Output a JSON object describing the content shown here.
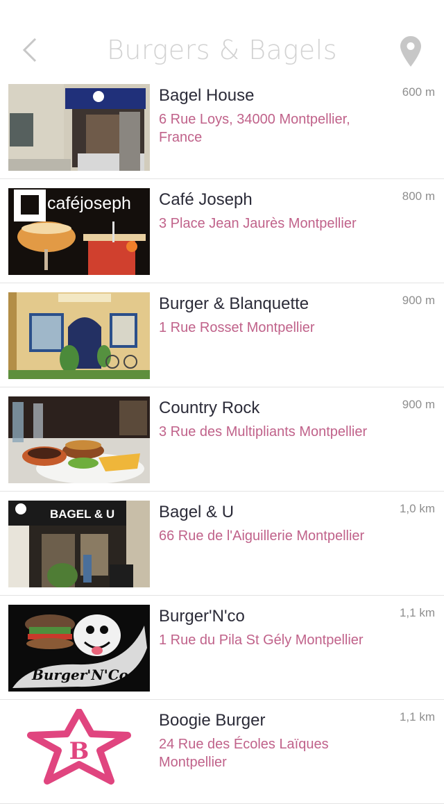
{
  "header": {
    "title": "Burgers & Bagels",
    "back_icon": "chevron-left-icon",
    "map_icon": "map-pin-icon",
    "title_color": "#d2d2d2",
    "icon_color": "#c7c7c7"
  },
  "theme": {
    "address_color": "#c0628a",
    "name_color": "#2b2b38",
    "distance_color": "#8e8e8e"
  },
  "restaurants": [
    {
      "name": "Bagel House",
      "address": "6 Rue Loys, 34000 Montpellier, France",
      "distance": "600 m"
    },
    {
      "name": "Café Joseph",
      "address": "3 Place Jean Jaurès Montpellier",
      "distance": "800 m",
      "logo_text": "caféjoseph"
    },
    {
      "name": "Burger & Blanquette",
      "address": "1 Rue Rosset Montpellier",
      "distance": "900 m"
    },
    {
      "name": "Country Rock",
      "address": "3 Rue des Multipliants Montpellier",
      "distance": "900 m"
    },
    {
      "name": "Bagel & U",
      "address": "66 Rue de l'Aiguillerie Montpellier",
      "distance": "1,0 km",
      "sign_text": "BAGEL & U"
    },
    {
      "name": "Burger'N'co",
      "address": "1 Rue du Pila St Gély Montpellier",
      "distance": "1,1 km",
      "logo_text": "Burger'N'Co"
    },
    {
      "name": "Boogie Burger",
      "address": "24 Rue des Écoles Laïques Montpellier",
      "distance": "1,1 km",
      "logo_text": "B"
    }
  ]
}
